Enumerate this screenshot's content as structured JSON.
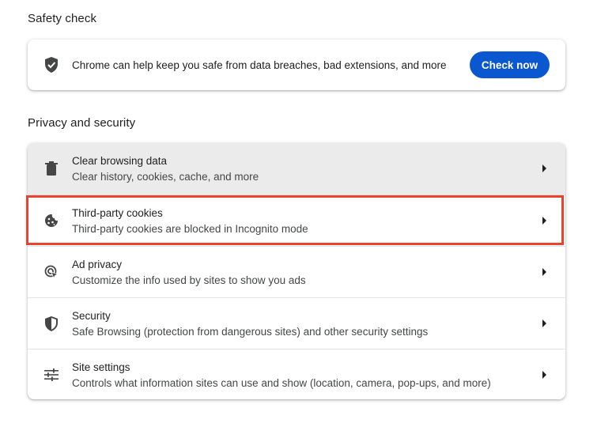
{
  "safety": {
    "heading": "Safety check",
    "description": "Chrome can help keep you safe from data breaches, bad extensions, and more",
    "button_label": "Check now",
    "icon": "shield-check-icon"
  },
  "privacy": {
    "heading": "Privacy and security",
    "items": [
      {
        "label": "Clear browsing data",
        "sublabel": "Clear history, cookies, cache, and more",
        "icon": "trash-icon"
      },
      {
        "label": "Third-party cookies",
        "sublabel": "Third-party cookies are blocked in Incognito mode",
        "icon": "cookie-icon"
      },
      {
        "label": "Ad privacy",
        "sublabel": "Customize the info used by sites to show you ads",
        "icon": "ad-privacy-icon"
      },
      {
        "label": "Security",
        "sublabel": "Safe Browsing (protection from dangerous sites) and other security settings",
        "icon": "shield-icon"
      },
      {
        "label": "Site settings",
        "sublabel": "Controls what information sites can use and show (location, camera, pop-ups, and more)",
        "icon": "sliders-icon"
      }
    ]
  },
  "colors": {
    "accent": "#0b57d0",
    "highlight": "#e8432c",
    "hover_row": "#ebebeb"
  }
}
